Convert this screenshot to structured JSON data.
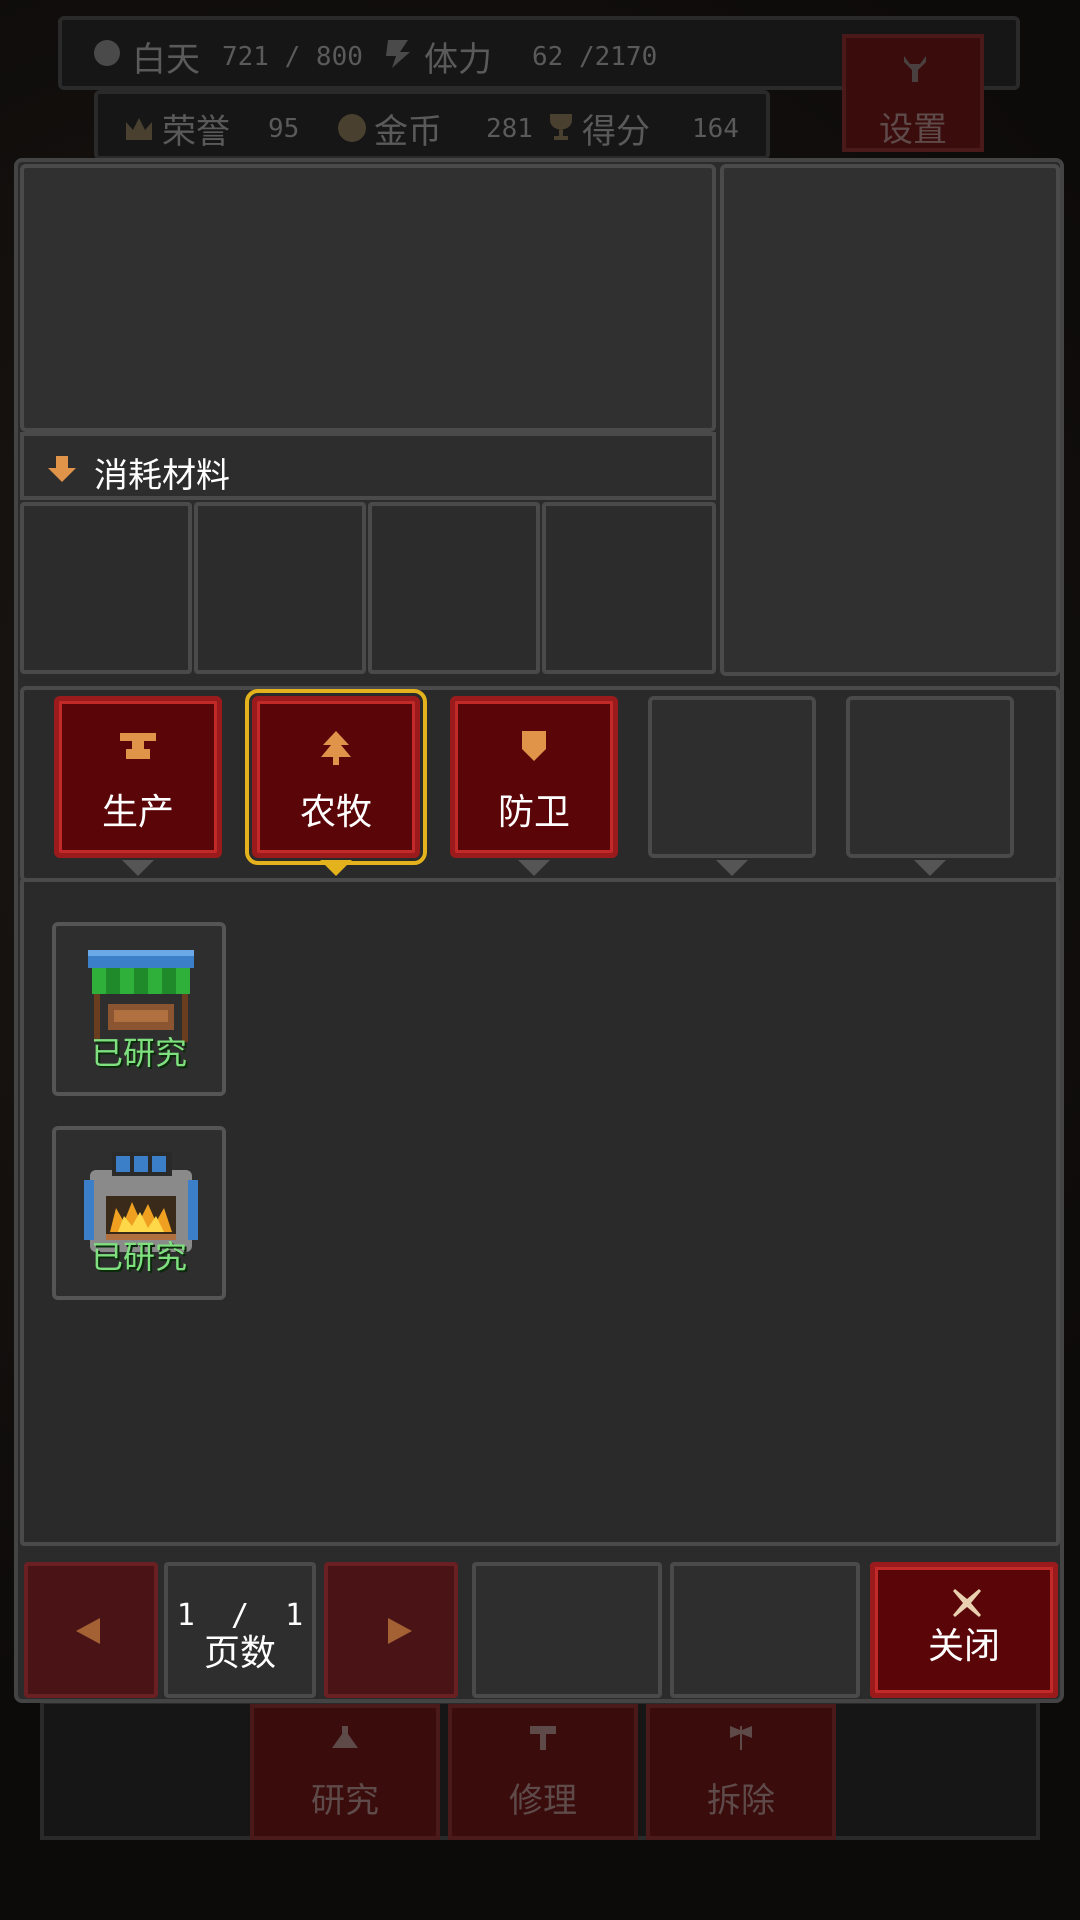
{
  "hud": {
    "daytime_label": "白天",
    "daytime_value": "721 / 800",
    "stamina_label": "体力",
    "stamina_value": "62 /2170",
    "honor_label": "荣誉",
    "honor_value": "95",
    "gold_label": "金币",
    "gold_value": "281",
    "score_label": "得分",
    "score_value": "164",
    "settings_label": "设置"
  },
  "materials": {
    "header_label": "消耗材料"
  },
  "tabs": [
    {
      "label": "生产",
      "icon": "anvil-icon",
      "state": "active"
    },
    {
      "label": "农牧",
      "icon": "tree-icon",
      "state": "selected"
    },
    {
      "label": "防卫",
      "icon": "shield-icon",
      "state": "active"
    },
    {
      "label": "",
      "icon": "",
      "state": "empty"
    },
    {
      "label": "",
      "icon": "",
      "state": "empty"
    }
  ],
  "items": [
    {
      "icon": "market-stall-icon",
      "status": "已研究"
    },
    {
      "icon": "furnace-icon",
      "status": "已研究"
    }
  ],
  "pagination": {
    "current": "1",
    "separator": "/",
    "total": "1",
    "label": "页数"
  },
  "close_label": "关闭",
  "bottom_actions": [
    {
      "label": "研究",
      "icon": "research-icon"
    },
    {
      "label": "修理",
      "icon": "hammer-icon"
    },
    {
      "label": "拆除",
      "icon": "axe-icon"
    }
  ],
  "colors": {
    "accent_red": "#9b1b1d",
    "selected_gold": "#e3b21c",
    "researched_green": "#7fe07f"
  }
}
